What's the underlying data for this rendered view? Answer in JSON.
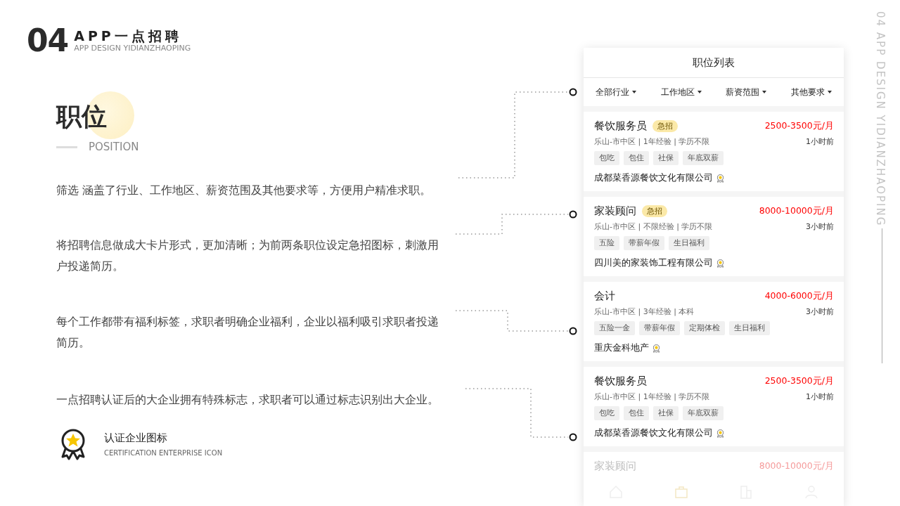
{
  "header": {
    "number": "04",
    "title": "APP一点招聘",
    "subtitle": "APP DESIGN YIDIANZHAOPING"
  },
  "side_label": "04 APP DESIGN YIDIANZHAOPING",
  "section": {
    "title": "职位",
    "subtitle": "POSITION"
  },
  "notes": [
    {
      "text": "筛选 涵盖了行业、工作地区、薪资范围及其他要求等，方便用户精准求职。"
    },
    {
      "text": "将招聘信息做成大卡片形式，更加清晰；为前两条职位设定急招图标，刺激用户投递简历。"
    },
    {
      "text": "每个工作都带有福利标签，求职者明确企业福利，企业以福利吸引求职者投递简历。"
    },
    {
      "text": "一点招聘认证后的大企业拥有特殊标志，求职者可以通过标志识别出大企业。"
    }
  ],
  "legend": {
    "title": "认证企业图标",
    "subtitle": "CERTIFICATION ENTERPRISE ICON"
  },
  "app": {
    "title": "职位列表",
    "filters": [
      "全部行业",
      "工作地区",
      "薪资范围",
      "其他要求"
    ],
    "jobs": [
      {
        "title": "餐饮服务员",
        "badge": "急招",
        "salary": "2500-3500元/月",
        "meta": "乐山-市中区 | 1年经验 | 学历不限",
        "time": "1小时前",
        "tags": [
          "包吃",
          "包住",
          "社保",
          "年底双薪"
        ],
        "company": "成都菜香源餐饮文化有限公司"
      },
      {
        "title": "家装顾问",
        "badge": "急招",
        "salary": "8000-10000元/月",
        "meta": "乐山-市中区 | 不限经验 | 学历不限",
        "time": "3小时前",
        "tags": [
          "五险",
          "带薪年假",
          "生日福利"
        ],
        "company": "四川美的家装饰工程有限公司"
      },
      {
        "title": "会计",
        "salary": "4000-6000元/月",
        "meta": "乐山-市中区 | 3年经验 | 本科",
        "time": "3小时前",
        "tags": [
          "五险一金",
          "带薪年假",
          "定期体检",
          "生日福利"
        ],
        "company": "重庆金科地产"
      },
      {
        "title": "餐饮服务员",
        "salary": "2500-3500元/月",
        "meta": "乐山-市中区 | 1年经验 | 学历不限",
        "time": "1小时前",
        "tags": [
          "包吃",
          "包住",
          "社保",
          "年底双薪"
        ],
        "company": "成都菜香源餐饮文化有限公司"
      },
      {
        "title": "家装顾问",
        "salary": "8000-10000元/月"
      }
    ]
  }
}
